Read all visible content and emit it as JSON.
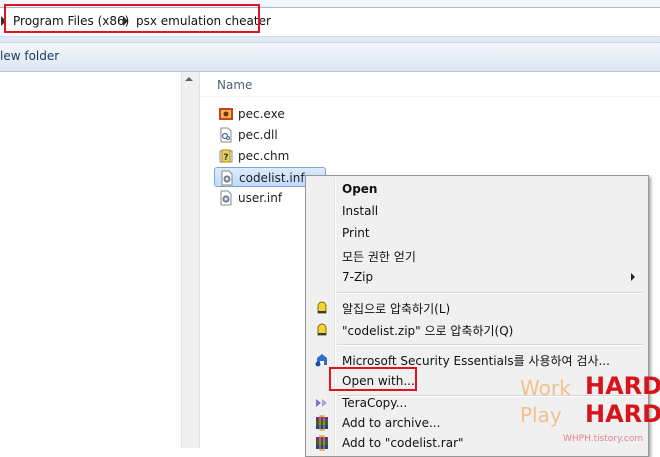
{
  "address_bar": {
    "crumbs": [
      "Program Files (x86)",
      "psx emulation cheater"
    ]
  },
  "toolbar": {
    "new_folder_label": "lew folder"
  },
  "file_list": {
    "column_header": "Name",
    "files": [
      {
        "name": "pec.exe",
        "icon": "exe-icon"
      },
      {
        "name": "pec.dll",
        "icon": "dll-icon"
      },
      {
        "name": "pec.chm",
        "icon": "help-file-icon"
      },
      {
        "name": "codelist.inf",
        "icon": "settings-file-icon",
        "selected": true
      },
      {
        "name": "user.inf",
        "icon": "settings-file-icon"
      }
    ]
  },
  "context_menu": {
    "items": [
      {
        "label": "Open",
        "bold": true
      },
      {
        "label": "Install"
      },
      {
        "label": "Print"
      },
      {
        "label": "모든 권한 얻기"
      },
      {
        "label": "7-Zip",
        "submenu": true
      },
      {
        "label": "알집으로 압축하기(L)",
        "icon": "alzip-icon"
      },
      {
        "label": "\"codelist.zip\" 으로 압축하기(Q)",
        "icon": "alzip-icon"
      },
      {
        "label": "Microsoft Security Essentials를 사용하여 검사...",
        "icon": "security-essentials-icon"
      },
      {
        "label": "Open with...",
        "highlighted": true
      },
      {
        "label": "TeraCopy...",
        "icon": "teracopy-icon"
      },
      {
        "label": "Add to archive...",
        "icon": "winrar-icon"
      },
      {
        "label": "Add to \"codelist.rar\"",
        "icon": "winrar-icon"
      }
    ]
  },
  "colors": {
    "highlight_border": "#e0141e",
    "selection_fill": "#c1dbfc"
  }
}
